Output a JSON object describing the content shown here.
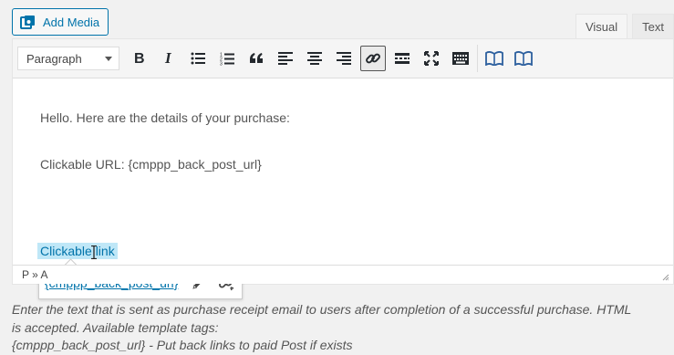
{
  "toolbar_top": {
    "add_media_label": "Add Media",
    "tabs": [
      {
        "label": "Visual",
        "active": true
      },
      {
        "label": "Text",
        "active": false
      }
    ]
  },
  "editor": {
    "format_select": "Paragraph",
    "buttons": [
      "bold-icon",
      "italic-icon",
      "bullet-list-icon",
      "numbered-list-icon",
      "blockquote-icon",
      "align-left-icon",
      "align-center-icon",
      "align-right-icon",
      "link-icon",
      "read-more-icon",
      "fullscreen-icon",
      "toolbar-toggle-icon",
      "book-icon",
      "book-icon"
    ],
    "content": {
      "line1": "Hello. Here are the details of your purchase:",
      "line2": "Clickable URL: {cmppp_back_post_url}",
      "selected_link_text": "Clickable link"
    },
    "link_popup": {
      "url": "{cmppp_back_post_url}"
    },
    "status_path": "P » A"
  },
  "description": {
    "line1": "Enter the text that is sent as purchase receipt email to users after completion of a successful purchase. HTML",
    "line2": "is accepted. Available template tags:",
    "line3": "{cmppp_back_post_url} - Put back links to paid Post if exists"
  },
  "colors": {
    "accent": "#0073aa",
    "selection": "#bfe7f7",
    "background": "#f1f1f1"
  }
}
